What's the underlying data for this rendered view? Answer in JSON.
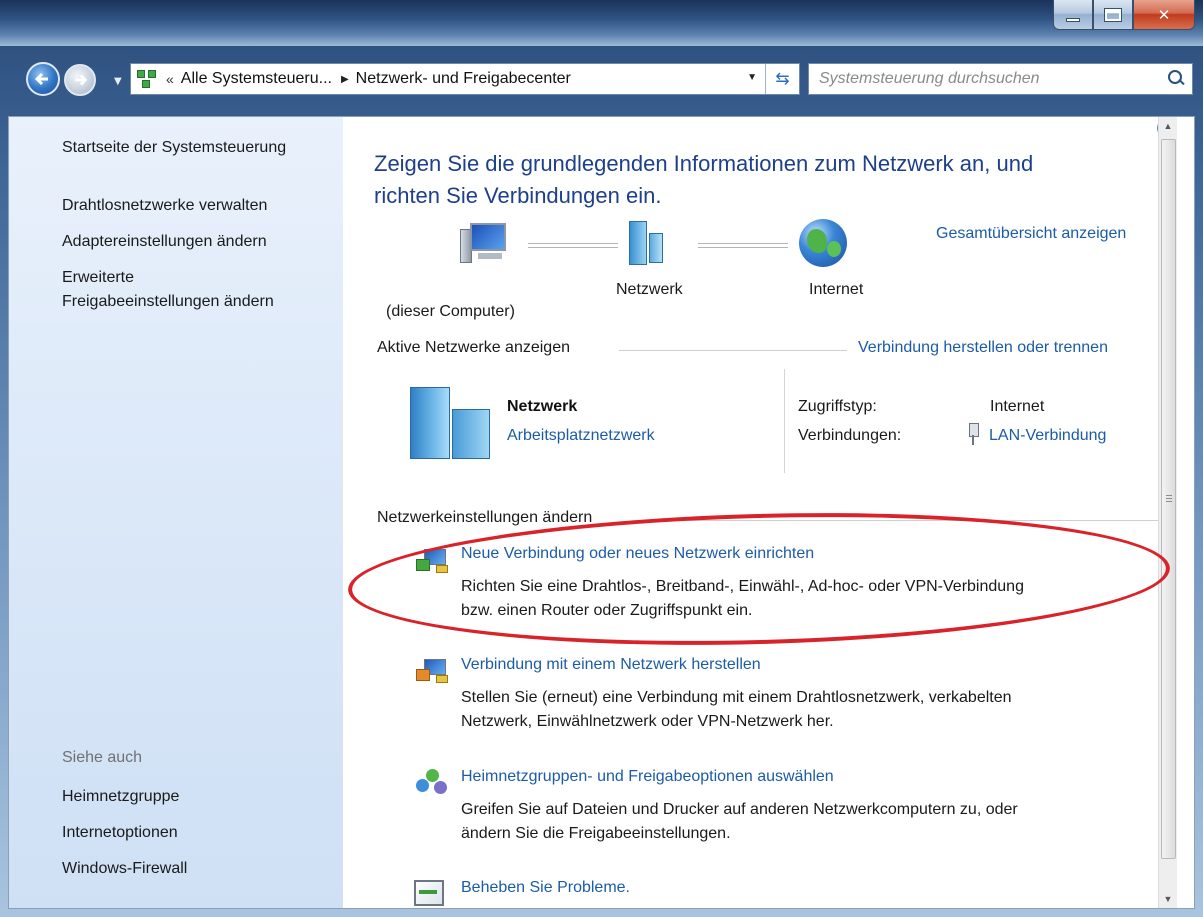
{
  "window": {
    "breadcrumb_prefix": "«",
    "breadcrumb_parent": "Alle Systemsteueru...",
    "breadcrumb_current": "Netzwerk- und Freigabecenter",
    "search_placeholder": "Systemsteuerung durchsuchen"
  },
  "sidebar": {
    "items": [
      "Startseite der Systemsteuerung",
      "Drahtlosnetzwerke verwalten",
      "Adaptereinstellungen ändern",
      "Erweiterte",
      "Freigabeeinstellungen ändern"
    ],
    "see_also_label": "Siehe auch",
    "see_also": [
      "Heimnetzgruppe",
      "Internetoptionen",
      "Windows-Firewall"
    ]
  },
  "main": {
    "heading_line1": "Zeigen Sie die grundlegenden Informationen zum Netzwerk an, und",
    "heading_line2": "richten Sie Verbindungen ein.",
    "overview_link": "Gesamtübersicht anzeigen",
    "map": {
      "computer": "(dieser Computer)",
      "network": "Netzwerk",
      "internet": "Internet"
    },
    "active_title": "Aktive Netzwerke anzeigen",
    "connect_link": "Verbindung herstellen oder trennen",
    "active_network": {
      "name": "Netzwerk",
      "type_link": "Arbeitsplatznetzwerk",
      "access_label": "Zugriffstyp:",
      "access_value": "Internet",
      "connections_label": "Verbindungen:",
      "connection_link": "LAN-Verbindung"
    },
    "change_title": "Netzwerkeinstellungen ändern",
    "tasks": [
      {
        "title": "Neue Verbindung oder neues Netzwerk einrichten",
        "line1": "Richten Sie eine Drahtlos-, Breitband-, Einwähl-, Ad-hoc- oder VPN-Verbindung",
        "line2": "bzw. einen Router oder Zugriffspunkt ein."
      },
      {
        "title": "Verbindung mit einem Netzwerk herstellen",
        "line1": "Stellen Sie (erneut) eine Verbindung mit einem Drahtlosnetzwerk, verkabelten",
        "line2": "Netzwerk, Einwählnetzwerk oder VPN-Netzwerk her."
      },
      {
        "title": "Heimnetzgruppen- und Freigabeoptionen auswählen",
        "line1": "Greifen Sie auf Dateien und Drucker auf anderen Netzwerkcomputern zu, oder",
        "line2": "ändern Sie die Freigabeeinstellungen."
      },
      {
        "title": "Beheben Sie Probleme."
      }
    ]
  },
  "colors": {
    "link": "#1c5ba8",
    "heading": "#1e3f8a",
    "annotation": "#d8232a"
  }
}
